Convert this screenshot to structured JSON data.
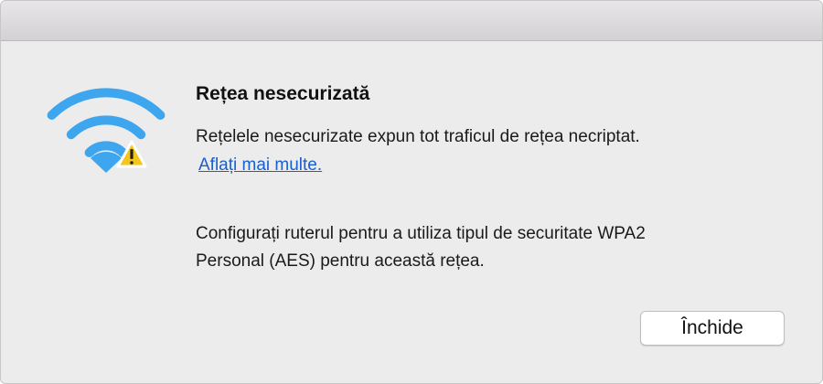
{
  "dialog": {
    "icon": "wifi-warning-icon",
    "title": "Rețea nesecurizată",
    "description": "Rețelele nesecurizate expun tot traficul de rețea necriptat.",
    "learn_more_link": "Aflați mai multe.",
    "advice_line_1": "Configurați ruterul pentru a utiliza tipul de securitate WPA2",
    "advice_line_2": "Personal (AES) pentru această rețea.",
    "close_button_label": "Închide"
  },
  "colors": {
    "wifi_blue": "#3ea6ef",
    "warning_yellow": "#f5c518",
    "link_blue": "#1a5fce",
    "window_background": "#ececec"
  }
}
